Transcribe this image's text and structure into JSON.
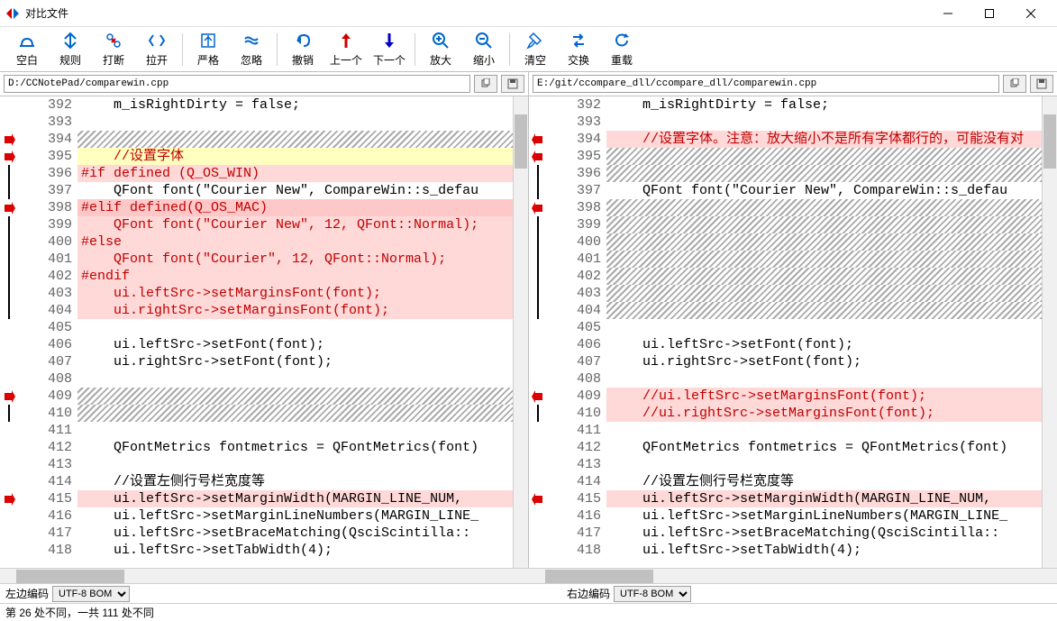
{
  "window": {
    "title": "对比文件"
  },
  "toolbar": [
    {
      "id": "blank",
      "label": "空白"
    },
    {
      "id": "rule",
      "label": "规则"
    },
    {
      "id": "break",
      "label": "打断"
    },
    {
      "id": "expand",
      "label": "拉开"
    },
    {
      "sep": true
    },
    {
      "id": "strict",
      "label": "严格"
    },
    {
      "id": "ignore",
      "label": "忽略"
    },
    {
      "sep": true
    },
    {
      "id": "undo",
      "label": "撤销"
    },
    {
      "id": "prev",
      "label": "上一个"
    },
    {
      "id": "next",
      "label": "下一个"
    },
    {
      "sep": true
    },
    {
      "id": "zoomin",
      "label": "放大"
    },
    {
      "id": "zoomout",
      "label": "缩小"
    },
    {
      "sep": true
    },
    {
      "id": "clear",
      "label": "清空"
    },
    {
      "id": "swap",
      "label": "交换"
    },
    {
      "id": "reload",
      "label": "重载"
    }
  ],
  "paths": {
    "left": "D:/CCNotePad/comparewin.cpp",
    "right": "E:/git/ccompare_dll/ccompare_dll/comparewin.cpp"
  },
  "left_lines": [
    {
      "n": 392,
      "m": "",
      "bg": "normal",
      "cls": "black",
      "t": "    m_isRightDirty = false;"
    },
    {
      "n": 393,
      "m": "",
      "bg": "normal",
      "cls": "black",
      "t": ""
    },
    {
      "n": 394,
      "m": "r",
      "bg": "hatch",
      "cls": "black",
      "t": ""
    },
    {
      "n": 395,
      "m": "r",
      "bg": "yellow",
      "cls": "red",
      "t": "    //设置字体"
    },
    {
      "n": 396,
      "m": "bar",
      "bg": "redlight",
      "cls": "red",
      "t": "#if defined (Q_OS_WIN)"
    },
    {
      "n": 397,
      "m": "bar",
      "bg": "normal",
      "cls": "black",
      "t": "    QFont font(\"Courier New\", CompareWin::s_defau"
    },
    {
      "n": 398,
      "m": "r",
      "bg": "redmid",
      "cls": "red",
      "t": "#elif defined(Q_OS_MAC)"
    },
    {
      "n": 399,
      "m": "bar",
      "bg": "redlight",
      "cls": "red",
      "t": "    QFont font(\"Courier New\", 12, QFont::Normal);"
    },
    {
      "n": 400,
      "m": "bar",
      "bg": "redlight",
      "cls": "red",
      "t": "#else"
    },
    {
      "n": 401,
      "m": "bar",
      "bg": "redlight",
      "cls": "red",
      "t": "    QFont font(\"Courier\", 12, QFont::Normal);"
    },
    {
      "n": 402,
      "m": "bar",
      "bg": "redlight",
      "cls": "red",
      "t": "#endif"
    },
    {
      "n": 403,
      "m": "bar",
      "bg": "redlight",
      "cls": "red",
      "t": "    ui.leftSrc->setMarginsFont(font);"
    },
    {
      "n": 404,
      "m": "bar",
      "bg": "redlight",
      "cls": "red",
      "t": "    ui.rightSrc->setMarginsFont(font);"
    },
    {
      "n": 405,
      "m": "",
      "bg": "normal",
      "cls": "black",
      "t": ""
    },
    {
      "n": 406,
      "m": "",
      "bg": "normal",
      "cls": "black",
      "t": "    ui.leftSrc->setFont(font);"
    },
    {
      "n": 407,
      "m": "",
      "bg": "normal",
      "cls": "black",
      "t": "    ui.rightSrc->setFont(font);"
    },
    {
      "n": 408,
      "m": "",
      "bg": "normal",
      "cls": "black",
      "t": ""
    },
    {
      "n": 409,
      "m": "r",
      "bg": "hatch",
      "cls": "black",
      "t": ""
    },
    {
      "n": 410,
      "m": "bar",
      "bg": "hatch",
      "cls": "black",
      "t": ""
    },
    {
      "n": 411,
      "m": "",
      "bg": "normal",
      "cls": "black",
      "t": ""
    },
    {
      "n": 412,
      "m": "",
      "bg": "normal",
      "cls": "black",
      "t": "    QFontMetrics fontmetrics = QFontMetrics(font)"
    },
    {
      "n": 413,
      "m": "",
      "bg": "normal",
      "cls": "black",
      "t": ""
    },
    {
      "n": 414,
      "m": "",
      "bg": "normal",
      "cls": "black",
      "t": "    //设置左侧行号栏宽度等"
    },
    {
      "n": 415,
      "m": "r",
      "bg": "redlight",
      "cls": "black",
      "t": "    ui.leftSrc->setMarginWidth(MARGIN_LINE_NUM, "
    },
    {
      "n": 416,
      "m": "",
      "bg": "normal",
      "cls": "black",
      "t": "    ui.leftSrc->setMarginLineNumbers(MARGIN_LINE_"
    },
    {
      "n": 417,
      "m": "",
      "bg": "normal",
      "cls": "black",
      "t": "    ui.leftSrc->setBraceMatching(QsciScintilla::"
    },
    {
      "n": 418,
      "m": "",
      "bg": "normal",
      "cls": "black",
      "t": "    ui.leftSrc->setTabWidth(4);"
    }
  ],
  "right_lines": [
    {
      "n": 392,
      "m": "",
      "bg": "normal",
      "cls": "black",
      "t": "    m_isRightDirty = false;"
    },
    {
      "n": 393,
      "m": "",
      "bg": "normal",
      "cls": "black",
      "t": ""
    },
    {
      "n": 394,
      "m": "l",
      "bg": "redlight",
      "cls": "red",
      "t": "    //设置字体。注意：放大缩小不是所有字体都行的，可能没有对"
    },
    {
      "n": 395,
      "m": "l",
      "bg": "hatch",
      "cls": "black",
      "t": ""
    },
    {
      "n": 396,
      "m": "bar",
      "bg": "hatch",
      "cls": "black",
      "t": ""
    },
    {
      "n": 397,
      "m": "bar",
      "bg": "normal",
      "cls": "black",
      "t": "    QFont font(\"Courier New\", CompareWin::s_defau"
    },
    {
      "n": 398,
      "m": "l",
      "bg": "hatch",
      "cls": "black",
      "t": ""
    },
    {
      "n": 399,
      "m": "bar",
      "bg": "hatch",
      "cls": "black",
      "t": ""
    },
    {
      "n": 400,
      "m": "bar",
      "bg": "hatch",
      "cls": "black",
      "t": ""
    },
    {
      "n": 401,
      "m": "bar",
      "bg": "hatch",
      "cls": "black",
      "t": ""
    },
    {
      "n": 402,
      "m": "bar",
      "bg": "hatch",
      "cls": "black",
      "t": ""
    },
    {
      "n": 403,
      "m": "bar",
      "bg": "hatch",
      "cls": "black",
      "t": ""
    },
    {
      "n": 404,
      "m": "bar",
      "bg": "hatch",
      "cls": "black",
      "t": ""
    },
    {
      "n": 405,
      "m": "",
      "bg": "normal",
      "cls": "black",
      "t": ""
    },
    {
      "n": 406,
      "m": "",
      "bg": "normal",
      "cls": "black",
      "t": "    ui.leftSrc->setFont(font);"
    },
    {
      "n": 407,
      "m": "",
      "bg": "normal",
      "cls": "black",
      "t": "    ui.rightSrc->setFont(font);"
    },
    {
      "n": 408,
      "m": "",
      "bg": "normal",
      "cls": "black",
      "t": ""
    },
    {
      "n": 409,
      "m": "l",
      "bg": "redlight",
      "cls": "red",
      "t": "    //ui.leftSrc->setMarginsFont(font);"
    },
    {
      "n": 410,
      "m": "bar",
      "bg": "redlight",
      "cls": "red",
      "t": "    //ui.rightSrc->setMarginsFont(font);"
    },
    {
      "n": 411,
      "m": "",
      "bg": "normal",
      "cls": "black",
      "t": ""
    },
    {
      "n": 412,
      "m": "",
      "bg": "normal",
      "cls": "black",
      "t": "    QFontMetrics fontmetrics = QFontMetrics(font)"
    },
    {
      "n": 413,
      "m": "",
      "bg": "normal",
      "cls": "black",
      "t": ""
    },
    {
      "n": 414,
      "m": "",
      "bg": "normal",
      "cls": "black",
      "t": "    //设置左侧行号栏宽度等"
    },
    {
      "n": 415,
      "m": "l",
      "bg": "redlight",
      "cls": "black",
      "t": "    ui.leftSrc->setMarginWidth(MARGIN_LINE_NUM, "
    },
    {
      "n": 416,
      "m": "",
      "bg": "normal",
      "cls": "black",
      "t": "    ui.leftSrc->setMarginLineNumbers(MARGIN_LINE_"
    },
    {
      "n": 417,
      "m": "",
      "bg": "normal",
      "cls": "black",
      "t": "    ui.leftSrc->setBraceMatching(QsciScintilla::"
    },
    {
      "n": 418,
      "m": "",
      "bg": "normal",
      "cls": "black",
      "t": "    ui.leftSrc->setTabWidth(4);"
    }
  ],
  "encoding": {
    "left_label": "左边编码",
    "left_value": "UTF-8 BOM",
    "right_label": "右边编码",
    "right_value": "UTF-8 BOM"
  },
  "status": "第 26 处不同，一共 111 处不同"
}
